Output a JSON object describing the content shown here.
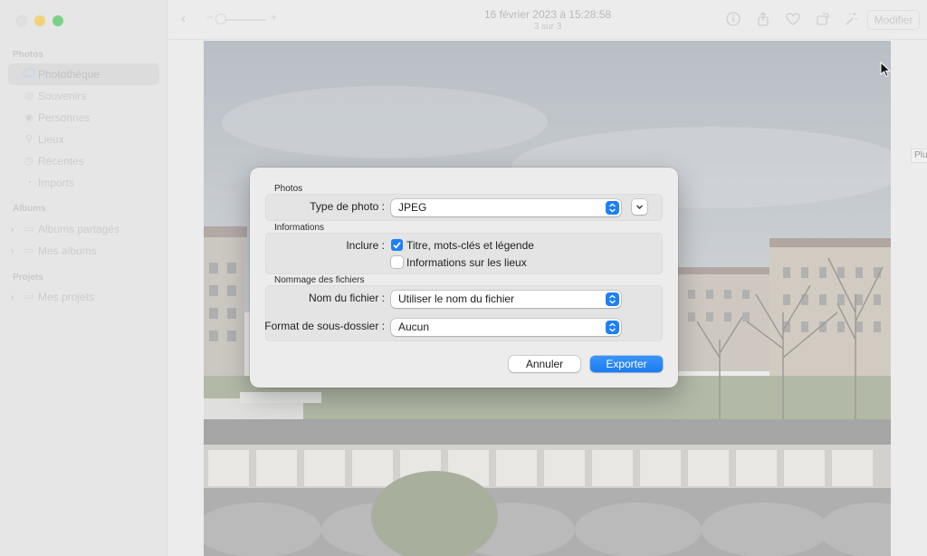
{
  "window": {
    "title": "16 février 2023 à 15:28:58",
    "subtitle": "3 sur 3",
    "edit_label": "Modifier"
  },
  "sidebar": {
    "sections": [
      {
        "title": "Photos"
      },
      {
        "title": "Albums"
      },
      {
        "title": "Projets"
      }
    ],
    "items": [
      {
        "label": "Photothèque",
        "icon": "photo-library-icon",
        "active": true
      },
      {
        "label": "Souvenirs",
        "icon": "memories-icon"
      },
      {
        "label": "Personnes",
        "icon": "people-icon"
      },
      {
        "label": "Lieux",
        "icon": "map-pin-icon"
      },
      {
        "label": "Récentes",
        "icon": "clock-icon"
      },
      {
        "label": "Imports",
        "icon": "import-icon"
      },
      {
        "label": "Albums partagés",
        "icon": "shared-albums-icon"
      },
      {
        "label": "Mes albums",
        "icon": "albums-icon"
      },
      {
        "label": "Mes projets",
        "icon": "projects-icon"
      }
    ]
  },
  "side_tip": {
    "label": "Plu"
  },
  "dialog": {
    "photos_section": "Photos",
    "photo_type_label": "Type de photo :",
    "photo_type_value": "JPEG",
    "info_section": "Informations",
    "include_label": "Inclure :",
    "include_title": "Titre, mots-clés et légende",
    "include_location": "Informations sur les lieux",
    "naming_section": "Nommage des fichiers",
    "filename_label": "Nom du fichier :",
    "filename_value": "Utiliser le nom du fichier",
    "subfolder_label": "Format de sous-dossier :",
    "subfolder_value": "Aucun",
    "cancel": "Annuler",
    "export": "Exporter"
  },
  "colors": {
    "accent": "#1f7ff5"
  }
}
